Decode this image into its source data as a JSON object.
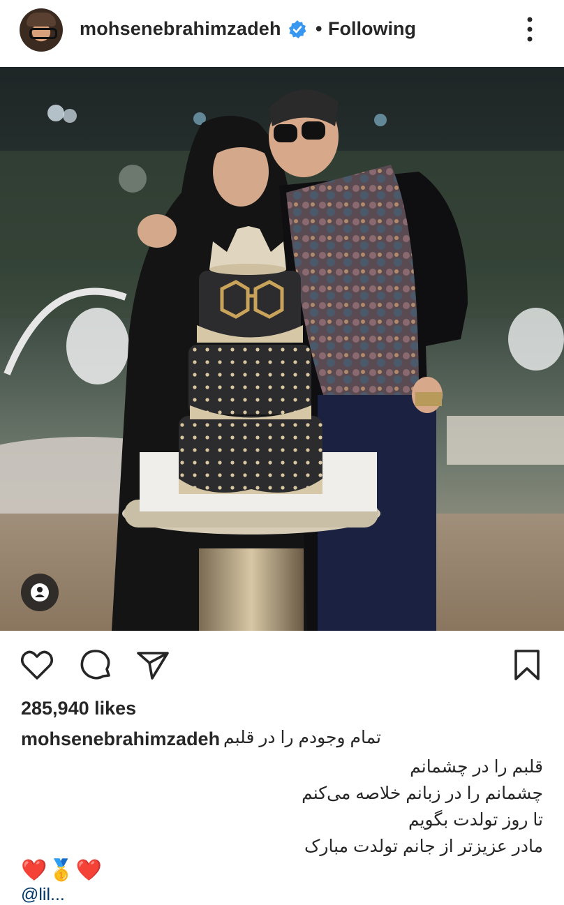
{
  "header": {
    "username": "mohsenebrahimzadeh",
    "separator": "•",
    "follow_status": "Following",
    "more_icon": "more-vertical-icon"
  },
  "post": {
    "tag_icon": "user-tag-icon"
  },
  "actions": {
    "like_icon": "heart-icon",
    "comment_icon": "comment-icon",
    "share_icon": "send-icon",
    "save_icon": "bookmark-icon"
  },
  "likes_text": "285,940 likes",
  "caption": {
    "username": "mohsenebrahimzadeh",
    "first_line": "تمام وجودم را در قلبم",
    "lines": [
      "قلبم را در چشمانم",
      "چشمانم را در زبانم خلاصه می‌کنم",
      "تا روز تولدت بگویم",
      "مادر عزیزتر از جانم تولدت مبارک"
    ],
    "emojis": "❤️🥇❤️"
  },
  "next_comment_preview": "@lil...",
  "colors": {
    "text": "#262626",
    "verified": "#3897f0",
    "background": "#ffffff"
  }
}
